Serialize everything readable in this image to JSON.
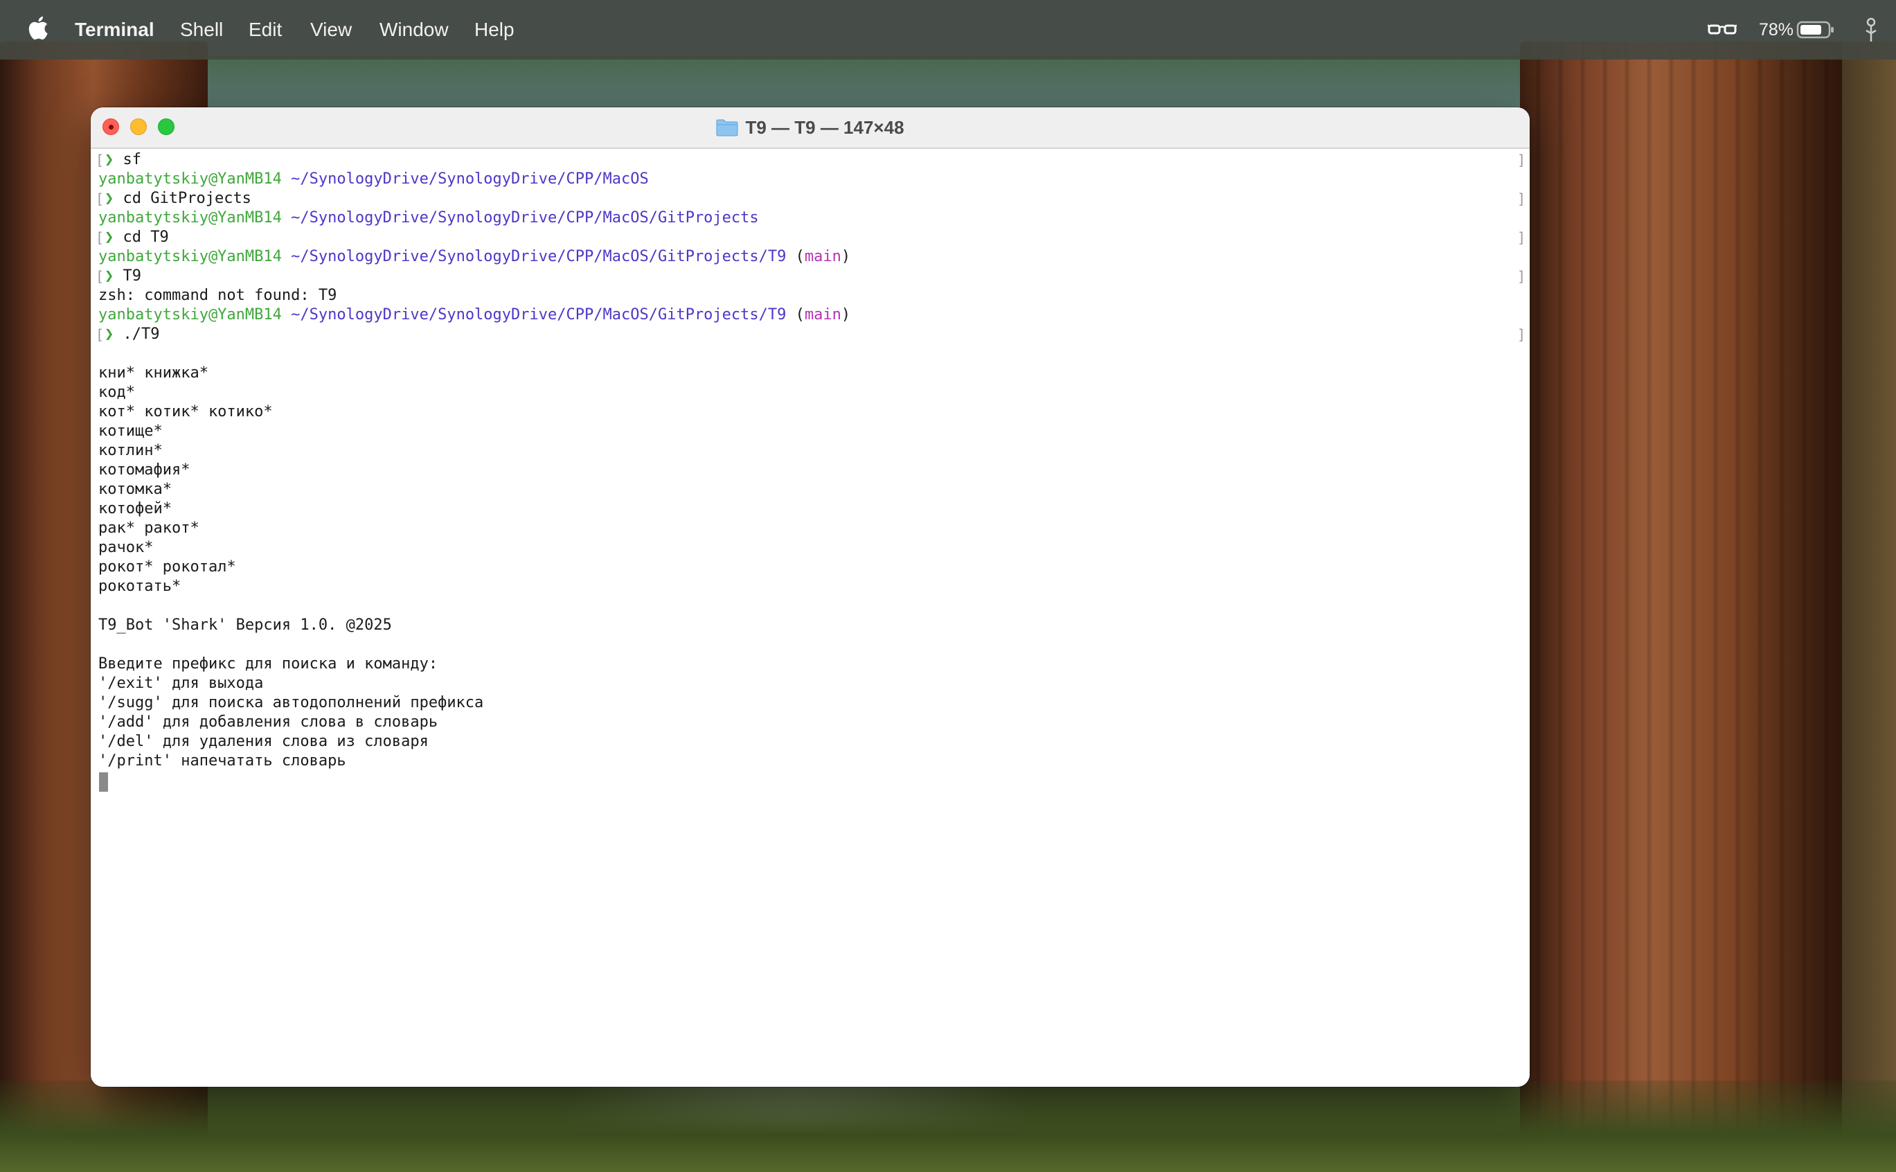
{
  "menubar": {
    "apple_icon": "apple-logo-icon",
    "app_name": "Terminal",
    "items": [
      "Shell",
      "Edit",
      "View",
      "Window",
      "Help"
    ],
    "battery_percent": "78%",
    "battery_level": 0.78,
    "status_icons": [
      "glasses-icon",
      "battery-icon",
      "accessibility-icon"
    ]
  },
  "window": {
    "title": "T9 — T9 — 147×48",
    "title_icon": "folder-icon",
    "traffic_lights": {
      "close": "#ff5f57",
      "minimize": "#febc2e",
      "zoom": "#28c840"
    }
  },
  "colors": {
    "prompt_user": "#3fa83b",
    "prompt_path": "#4b38c8",
    "git_branch": "#b733b3",
    "text": "#1a1a1a"
  },
  "terminal": {
    "prompt_symbol": "❯",
    "user_host": "yanbatytskiy@YanMB14",
    "branch": "main",
    "cmd1": "sf",
    "path1": "~/SynologyDrive/SynologyDrive/CPP/MacOS",
    "cmd2": "cd GitProjects",
    "path2": "~/SynologyDrive/SynologyDrive/CPP/MacOS/GitProjects",
    "cmd3": "cd T9",
    "path3": "~/SynologyDrive/SynologyDrive/CPP/MacOS/GitProjects/T9",
    "cmd4": "T9",
    "error": "zsh: command not found: T9",
    "path4": "~/SynologyDrive/SynologyDrive/CPP/MacOS/GitProjects/T9",
    "cmd5": "./T9",
    "output": [
      "",
      "кни* книжка*",
      "код*",
      "кот* котик* котико*",
      "котище*",
      "котлин*",
      "котомафия*",
      "котомка*",
      "котофей*",
      "рак* ракот*",
      "рачок*",
      "рокот* рокотал*",
      "рокотать*",
      "",
      "T9_Bot 'Shark' Версия 1.0. @2025",
      "",
      "Введите префикс для поиска и команду:",
      "'/exit' для выхода",
      "'/sugg' для поиска автодополнений префикса",
      "'/add' для добавления слова в словарь",
      "'/del' для удаления слова из словаря",
      "'/print' напечатать словарь"
    ]
  }
}
